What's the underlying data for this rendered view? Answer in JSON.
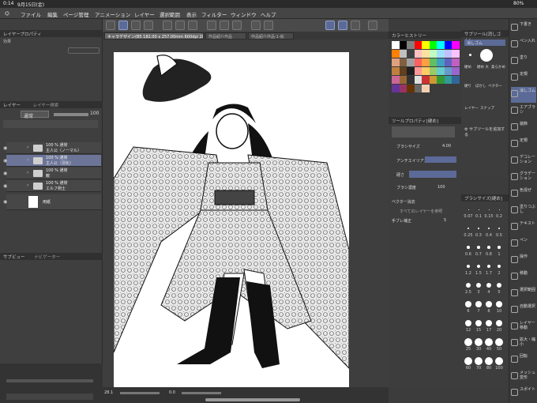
{
  "status": {
    "time": "0:14",
    "date": "9月15日(金)",
    "battery": "80%"
  },
  "menu": [
    "ファイル",
    "編集",
    "ページ管理",
    "アニメーション",
    "レイヤー",
    "選択範囲",
    "表示",
    "フィルター",
    "ウィンドウ",
    "ヘルプ"
  ],
  "panels": {
    "layer_property": "レイヤープロパティ",
    "effect": "効果",
    "layer": "レイヤー",
    "layer_search": "レイヤー検索",
    "blend_mode": "通常",
    "opacity": "100",
    "sub_view": "サブビュー",
    "navigator": "ナビゲーター",
    "color_history": "カラーヒストリー",
    "tool_property": "ツールプロパティ[硬め]",
    "sub_tool": "サブツール[消しゴム]",
    "sub_tool_group": "消しゴム",
    "add_sub_tool": "サブツールを追加する",
    "brush_size_panel": "ブラシサイズ[硬め]"
  },
  "canvas_tabs": [
    "キャラデザイン(B5 182.00 x 257.00mm 600dpi 28.1%)",
    "作品紹介作品",
    "作品紹介作品-1-仮"
  ],
  "layers": [
    {
      "line1": "100 % 通常",
      "line2": "主人公（ノーマル）",
      "selected": false
    },
    {
      "line1": "100 % 通常",
      "line2": "主人公（羽化）",
      "selected": true
    },
    {
      "line1": "100 % 通常",
      "line2": "敵",
      "selected": false
    },
    {
      "line1": "100 % 通常",
      "line2": "エルフ剣士",
      "selected": false
    },
    {
      "line1": "",
      "line2": "用紙",
      "selected": false
    }
  ],
  "tool_property": {
    "brush_size_label": "ブラシサイズ",
    "brush_size_value": "4.00",
    "antialias_label": "アンチエイリアス",
    "hardness_label": "硬さ",
    "brush_density_label": "ブラシ濃度",
    "brush_density_value": "100",
    "vector_erase_label": "ベクター消去",
    "all_layers_label": "すべてのレイヤーを参照",
    "stabilization_label": "手ブレ補正",
    "stabilization_value": "5"
  },
  "sub_tools": [
    "硬め",
    "硬め 大",
    "柔らかめ",
    "硬り",
    "ぼかし",
    "ベクター",
    "レイヤー",
    "スナップ"
  ],
  "brush_sizes": [
    [
      "0.07",
      "0.1",
      "0.15",
      "0.2"
    ],
    [
      "0.25",
      "0.3",
      "0.4",
      "0.5"
    ],
    [
      "0.6",
      "0.7",
      "0.8",
      "1"
    ],
    [
      "1.2",
      "1.5",
      "1.7",
      "2"
    ],
    [
      "2.5",
      "3",
      "4",
      "5"
    ],
    [
      "6",
      "7",
      "8",
      "10"
    ],
    [
      "12",
      "15",
      "17",
      "20"
    ],
    [
      "25",
      "30",
      "40",
      "50"
    ],
    [
      "60",
      "70",
      "80",
      "100"
    ]
  ],
  "right_tools": [
    "下書き",
    "ペン入れ",
    "塗り",
    "定規",
    "消しゴム",
    "エアブラシ",
    "装飾",
    "定規",
    "デコレーション",
    "グラデーション",
    "色混ぜ",
    "塗りつぶし",
    "テキスト",
    "ペン",
    "操作",
    "移動",
    "選択範囲",
    "自動選択",
    "レイヤー移動",
    "拡大・縮小",
    "回転",
    "メッシュ変形",
    "スポイト"
  ],
  "zoom": "28.1",
  "rotation": "0.0",
  "colors": {
    "accent": "#5b6a96",
    "palette": [
      "#ffffff",
      "#000000",
      "#808080",
      "#ff0000",
      "#ffff00",
      "#00ff00",
      "#00ffff",
      "#0000ff",
      "#ff00ff",
      "#ff8000",
      "#c0c0c0",
      "#404040",
      "#ffc0c0",
      "#ffe0a0",
      "#c0ffc0",
      "#a0e0ff",
      "#c0c0ff",
      "#ffc0ff",
      "#e0a080",
      "#806040",
      "#a0a0a0",
      "#ff6060",
      "#ffa040",
      "#60c060",
      "#40a0c0",
      "#6060c0",
      "#c060c0",
      "#c08040",
      "#604020",
      "#202020",
      "#ff9999",
      "#ffcc66",
      "#99cc66",
      "#66cccc",
      "#6699cc",
      "#9966cc",
      "#cc6699",
      "#996633",
      "#333333",
      "#e0e0e0",
      "#cc3333",
      "#cc9933",
      "#339933",
      "#339999",
      "#336699",
      "#663399",
      "#993366",
      "#663300",
      "#666666",
      "#f0d0b0"
    ]
  }
}
